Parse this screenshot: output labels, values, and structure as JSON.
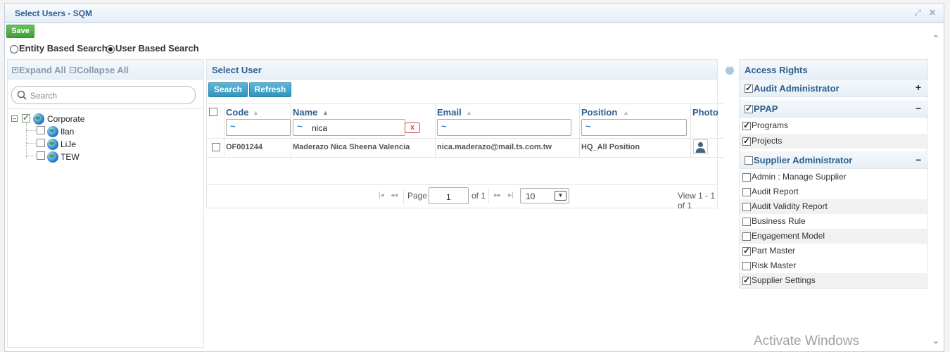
{
  "dialog": {
    "title": "Select Users - SQM",
    "save_label": "Save"
  },
  "search_mode": {
    "options": [
      {
        "label": "Entity Based Search",
        "selected": false
      },
      {
        "label": "User Based Search",
        "selected": true
      }
    ]
  },
  "tree_panel": {
    "expand_all": "Expand All",
    "collapse_all": "Collapse All",
    "search_placeholder": "Search",
    "nodes": [
      {
        "label": "Corporate",
        "checked": true
      },
      {
        "label": "Ilan",
        "checked": false
      },
      {
        "label": "LiJe",
        "checked": false
      },
      {
        "label": "TEW",
        "checked": false
      }
    ]
  },
  "user_panel": {
    "title": "Select User",
    "search_label": "Search",
    "refresh_label": "Refresh",
    "columns": {
      "code": "Code",
      "name": "Name",
      "email": "Email",
      "position": "Position",
      "photo": "Photo"
    },
    "filters": {
      "code": "",
      "name": "nica",
      "email": "",
      "position": ""
    },
    "filter_clear": "x",
    "rows": [
      {
        "code": "OF001244",
        "name": "Maderazo Nica Sheena  Valencia",
        "email": "nica.maderazo@mail.ts.com.tw",
        "position": "HQ_All Position"
      }
    ],
    "pager": {
      "page_label": "Page",
      "page_value": "1",
      "of_label": "of 1",
      "page_size": "10",
      "view_text": "View 1 - 1 of 1"
    }
  },
  "access_rights": {
    "title": "Access Rights",
    "groups": [
      {
        "label": "Audit Administrator",
        "checked": true,
        "toggle": "+",
        "items": []
      },
      {
        "label": "PPAP",
        "checked": true,
        "toggle": "–",
        "items": [
          {
            "label": "Programs",
            "checked": true
          },
          {
            "label": "Projects",
            "checked": true
          }
        ]
      },
      {
        "label": "Supplier Administrator",
        "checked": false,
        "toggle": "–",
        "items": [
          {
            "label": "Admin : Manage Supplier",
            "checked": false
          },
          {
            "label": "Audit Report",
            "checked": false
          },
          {
            "label": "Audit Validity Report",
            "checked": false
          },
          {
            "label": "Business Rule",
            "checked": false
          },
          {
            "label": "Engagement Model",
            "checked": false
          },
          {
            "label": "Part Master",
            "checked": true
          },
          {
            "label": "Risk Master",
            "checked": false
          },
          {
            "label": "Supplier Settings",
            "checked": true
          }
        ]
      }
    ]
  },
  "watermark": "Activate Windows"
}
